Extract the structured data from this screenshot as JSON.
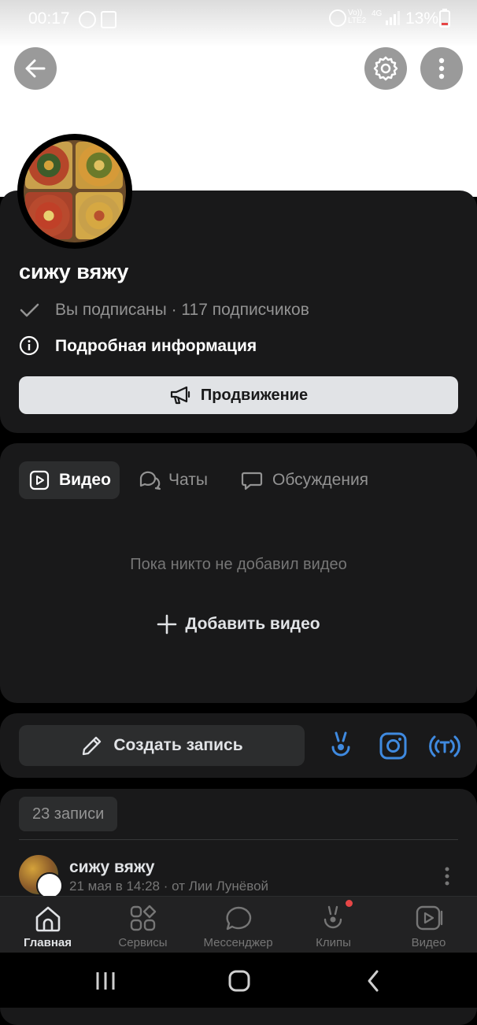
{
  "status_bar": {
    "time": "00:17",
    "battery": "13%",
    "network_volte": "Vo)) LTE2",
    "network_gen": "4G"
  },
  "header": {
    "back_icon": "arrow-left-icon",
    "settings_icon": "gear-icon",
    "more_icon": "more-vertical-icon"
  },
  "profile": {
    "name": "сижу вяжу",
    "subscription": "Вы подписаны · 117 подписчиков",
    "info_label": "Подробная информация",
    "promo_label": "Продвижение"
  },
  "media_tabs": {
    "tabs": [
      {
        "label": "Видео",
        "icon": "play-square-icon",
        "active": true
      },
      {
        "label": "Чаты",
        "icon": "chats-icon",
        "active": false
      },
      {
        "label": "Обсуждения",
        "icon": "comment-icon",
        "active": false
      }
    ],
    "empty_text": "Пока никто не добавил видео",
    "add_video_label": "Добавить видео"
  },
  "create_post": {
    "label": "Создать запись",
    "actions": [
      "clip-icon",
      "camera-icon",
      "live-stream-icon"
    ]
  },
  "posts": {
    "count_label": "23 записи",
    "first_post": {
      "author": "сижу вяжу",
      "meta": "21 мая в 14:28 · от Лии Лунёвой"
    }
  },
  "bottom_nav": {
    "items": [
      {
        "label": "Главная",
        "icon": "home-icon",
        "active": true
      },
      {
        "label": "Сервисы",
        "icon": "services-icon",
        "active": false
      },
      {
        "label": "Мессенджер",
        "icon": "messenger-icon",
        "active": false
      },
      {
        "label": "Клипы",
        "icon": "clips-icon",
        "active": false,
        "badge": true
      },
      {
        "label": "Видео",
        "icon": "video-icon",
        "active": false
      }
    ]
  },
  "colors": {
    "accent": "#3f8ae0",
    "card_bg": "#19191a",
    "badge": "#e64646"
  }
}
